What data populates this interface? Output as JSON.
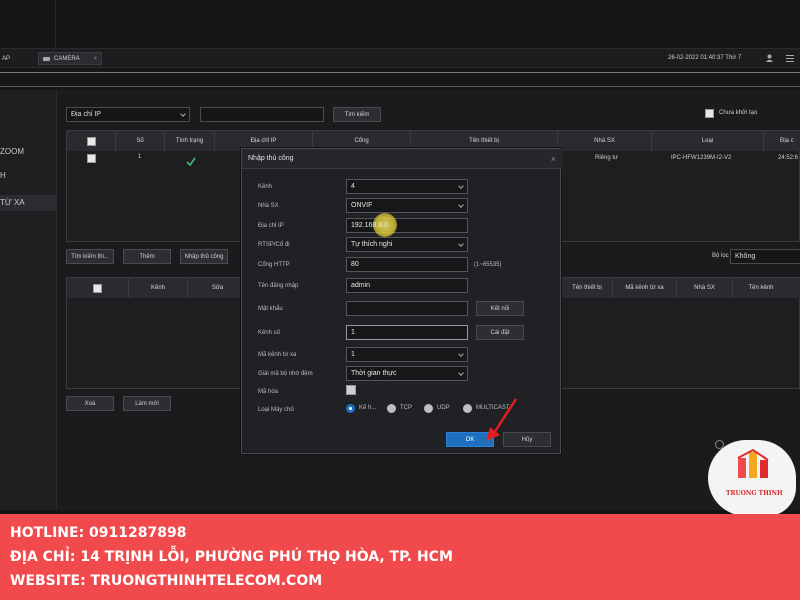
{
  "topbar": {
    "left_tab": "AP",
    "camera_tab": "CAMERA",
    "datetime": "26-02-2022 01:40:37 Thứ 7"
  },
  "sidebar": {
    "items": [
      "ZOOM",
      "H",
      "TỪ XA"
    ]
  },
  "filter": {
    "ip_select": "Địa chỉ IP",
    "search_value": "",
    "search_button": "Tìm kiếm",
    "uninit_label": "Chưa khởi tạo"
  },
  "device_table": {
    "headers": [
      "Số",
      "Tình trạng",
      "Địa chỉ IP",
      "Cổng",
      "Tên thiết bị",
      "Nhà SX",
      "Loại",
      "Địa c"
    ],
    "rows": [
      {
        "no": "1",
        "status_icon": "check-icon",
        "vendor": "Riêng tư",
        "type": "IPC-HFW1239M-I2-V2",
        "mac": "24:52:6"
      }
    ]
  },
  "actions": {
    "search_device": "Tìm kiếm thi...",
    "add": "Thêm",
    "manual_add": "Nhập thủ công",
    "filter_label": "Bộ lọc",
    "filter_value": "Không"
  },
  "added_table": {
    "headers": [
      "Kênh",
      "Sửa",
      "Tên thiết bị",
      "Mã kênh từ xa",
      "Nhà SX",
      "Tên kênh"
    ]
  },
  "bottom_buttons": {
    "delete": "Xoá",
    "refresh": "Làm mới"
  },
  "dialog": {
    "title": "Nhập thủ công",
    "labels": {
      "channel": "Kênh",
      "vendor": "Nhà SX",
      "ip": "Địa chỉ IP",
      "rtsp": "RTSP/Cổ đi",
      "http_port": "Cổng HTTP",
      "username": "Tên đăng nhập",
      "password": "Mật khẩu",
      "channel_no": "Kênh số",
      "remote_channel": "Mã kênh từ xa",
      "decode_buffer": "Giải mã bộ nhớ đệm",
      "encrypt": "Mã hóa",
      "server_type": "Loại Máy chủ"
    },
    "values": {
      "channel": "4",
      "vendor": "ONVIF",
      "ip": "192.168.8.0",
      "rtsp": "Tự thích nghi",
      "http_port": "80",
      "http_range": "(1~65535)",
      "username": "admin",
      "password": "",
      "channel_no": "1",
      "remote_channel": "1",
      "decode_buffer": "Thời gian thực"
    },
    "buttons": {
      "connect": "Kết nối",
      "settings": "Cài đặt",
      "ok": "OK",
      "cancel": "Hủy"
    },
    "server_options": [
      "Kế h...",
      "TCP",
      "UDP",
      "MULTICAST"
    ]
  },
  "brand": {
    "name": "TRUONG THINH"
  },
  "footer": {
    "hotline": "HOTLINE: 0911287898",
    "address": "ĐỊA CHỈ: 14 TRỊNH LỖI, PHƯỜNG PHÚ THỌ HÒA, TP. HCM",
    "website": "WEBSITE: TRUONGTHINHTELECOM.COM"
  },
  "colors": {
    "footer_bg": "#f04a4d",
    "ok_button": "#1e6fbf",
    "check": "#3cc07a",
    "highlight": "#e6d54a",
    "arrow": "#e02020"
  }
}
